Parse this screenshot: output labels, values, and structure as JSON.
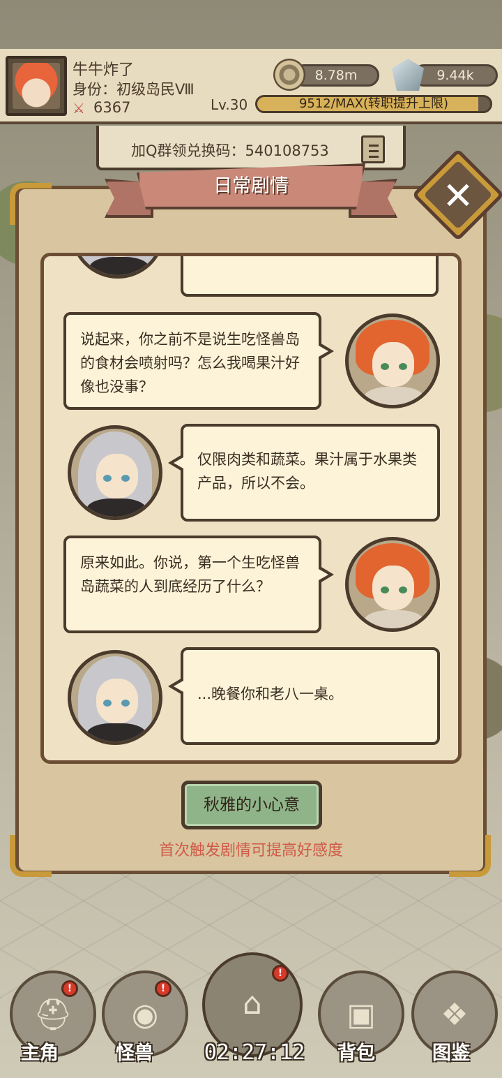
{
  "header": {
    "player_name": "牛牛炸了",
    "player_title": "身份：初级岛民Ⅷ",
    "power_value": "6367",
    "gold": "8.78m",
    "crystal": "9.44k",
    "level": "Lv.30",
    "exp_text": "9512/MAX(转职提升上限)",
    "exp_fraction": 0.95
  },
  "banner": {
    "code_text": "加Q群领兑换码：540108753"
  },
  "dialog": {
    "title": "日常剧情",
    "close": "✕",
    "messages": [
      {
        "speaker": "boy",
        "text": "说起来，你之前不是说生吃怪兽岛的食材会喷射吗？怎么我喝果汁好像也没事？"
      },
      {
        "speaker": "girl",
        "text": "仅限肉类和蔬菜。果汁属于水果类产品，所以不会。"
      },
      {
        "speaker": "boy",
        "text": "原来如此。你说，第一个生吃怪兽岛蔬菜的人到底经历了什么？"
      },
      {
        "speaker": "girl",
        "text": "...晚餐你和老八一桌。"
      }
    ],
    "gift_button": "秋雅的小心意",
    "hint": "首次触发剧情可提高好感度"
  },
  "nav": {
    "hero": "主角",
    "monster": "怪兽",
    "bag": "背包",
    "atlas": "图鉴",
    "timer": "02:27:12",
    "badge": "!"
  },
  "colors": {
    "accent_gold": "#c99a3a",
    "hint_red": "#d05a48",
    "gift_green": "#8fb48a"
  }
}
